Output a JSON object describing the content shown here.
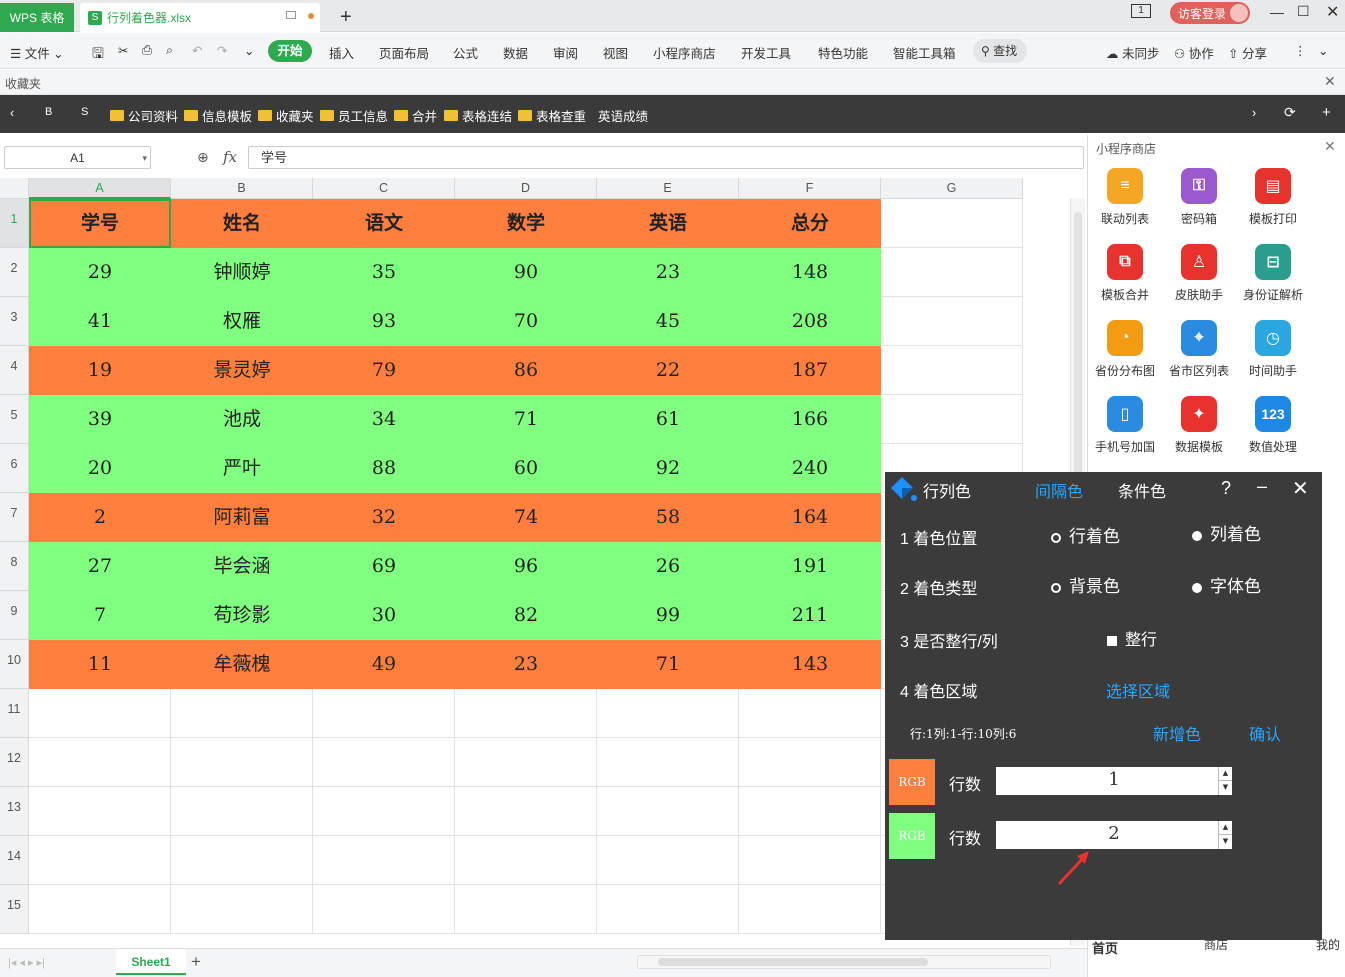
{
  "titlebar": {
    "app_tab": "WPS 表格",
    "file_tab": "行列着色器.xlsx",
    "login": "访客登录"
  },
  "menubar": {
    "file": "文件",
    "tabs": [
      "开始",
      "插入",
      "页面布局",
      "公式",
      "数据",
      "审阅",
      "视图",
      "小程序商店",
      "开发工具",
      "特色功能",
      "智能工具箱"
    ],
    "search": "查找",
    "sync": "未同步",
    "collab": "协作",
    "share": "分享"
  },
  "favbar": {
    "label": "收藏夹"
  },
  "bookmarks": [
    "B",
    "S",
    "公司资料",
    "信息模板",
    "收藏夹",
    "员工信息",
    "合并",
    "表格连结",
    "表格查重",
    "英语成绩"
  ],
  "formula": {
    "cell_ref": "A1",
    "fx": "fx",
    "value": "学号"
  },
  "grid": {
    "columns": [
      "A",
      "B",
      "C",
      "D",
      "E",
      "F",
      "G"
    ],
    "header_row": [
      "学号",
      "姓名",
      "语文",
      "数学",
      "英语",
      "总分"
    ],
    "rows": [
      [
        "29",
        "钟顺婷",
        "35",
        "90",
        "23",
        "148"
      ],
      [
        "41",
        "权雁",
        "93",
        "70",
        "45",
        "208"
      ],
      [
        "19",
        "景灵婷",
        "79",
        "86",
        "22",
        "187"
      ],
      [
        "39",
        "池成",
        "34",
        "71",
        "61",
        "166"
      ],
      [
        "20",
        "严叶",
        "88",
        "60",
        "92",
        "240"
      ],
      [
        "2",
        "阿莉富",
        "32",
        "74",
        "58",
        "164"
      ],
      [
        "27",
        "毕会涵",
        "69",
        "96",
        "26",
        "191"
      ],
      [
        "7",
        "苟珍影",
        "30",
        "82",
        "99",
        "211"
      ],
      [
        "11",
        "牟薇槐",
        "49",
        "23",
        "71",
        "143"
      ]
    ],
    "row_numbers": [
      "1",
      "2",
      "3",
      "4",
      "5",
      "6",
      "7",
      "8",
      "9",
      "10",
      "11",
      "12",
      "13",
      "14",
      "15"
    ],
    "row_colors": [
      "#ff7f3f",
      "#80ff80",
      "#80ff80",
      "#ff7f3f",
      "#80ff80",
      "#80ff80",
      "#ff7f3f",
      "#80ff80",
      "#80ff80",
      "#ff7f3f"
    ]
  },
  "sidepanel": {
    "title": "小程序商店",
    "apps": [
      "联动列表",
      "密码箱",
      "模板打印",
      "模板合并",
      "皮肤助手",
      "身份证解析",
      "省份分布图",
      "省市区列表",
      "时间助手",
      "手机号加国",
      "数据模板",
      "数值处理"
    ],
    "bottom": [
      "首页",
      "商店",
      "我的"
    ]
  },
  "dialog": {
    "title": "行列色",
    "tab_interval": "间隔色",
    "tab_condition": "条件色",
    "help": "?",
    "row1_label": "1 着色位置",
    "row1_opt1": "行着色",
    "row1_opt2": "列着色",
    "row2_label": "2 着色类型",
    "row2_opt1": "背景色",
    "row2_opt2": "字体色",
    "row3_label": "3 是否整行/列",
    "row3_opt": "整行",
    "row4_label": "4 着色区域",
    "row4_link": "选择区域",
    "range_info": "行:1列:1-行:10列:6",
    "add_color": "新增色",
    "confirm": "确认",
    "entries": [
      {
        "rgb": "RGB",
        "label": "行数",
        "value": "1",
        "color": "#ff7f3f"
      },
      {
        "rgb": "RGB",
        "label": "行数",
        "value": "2",
        "color": "#80ff80"
      }
    ]
  },
  "sheet": {
    "name": "Sheet1"
  }
}
